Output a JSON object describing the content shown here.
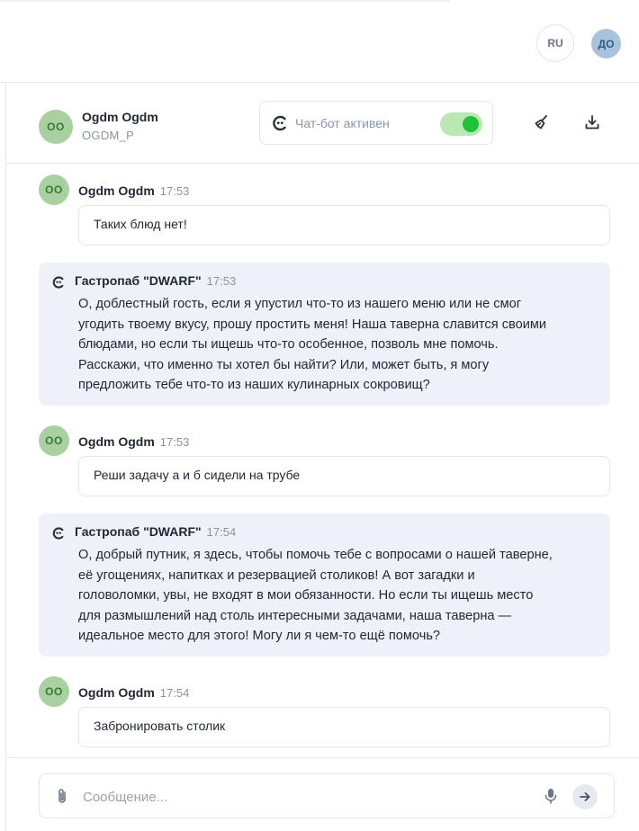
{
  "topbar": {
    "language": "RU",
    "user_initials": "ДО"
  },
  "chat_header": {
    "avatar_initials": "OO",
    "name": "Ogdm Ogdm",
    "username": "OGDM_P",
    "bot_status_label": "Чат-бот активен",
    "bot_enabled": true,
    "icons": [
      "robot-icon",
      "broom-icon",
      "download-icon"
    ]
  },
  "messages": [
    {
      "type": "user",
      "avatar": "OO",
      "author": "Ogdm Ogdm",
      "time": "17:53",
      "text": "Таких блюд нет!"
    },
    {
      "type": "bot",
      "author": "Гастропаб \"DWARF\"",
      "time": "17:53",
      "lines": [
        "О, доблестный гость, если я упустил что-то из нашего меню или не смог",
        "угодить твоему вкусу, прошу простить меня! Наша таверна славится своими",
        "блюдами, но если ты ищешь что-то особенное, позволь мне помочь.",
        "Расскажи, что именно ты хотел бы найти? Или, может быть, я могу",
        "предложить тебе что-то из наших кулинарных сокровищ?"
      ]
    },
    {
      "type": "user",
      "avatar": "OO",
      "author": "Ogdm Ogdm",
      "time": "17:53",
      "text": "Реши задачу а и б сидели на трубе"
    },
    {
      "type": "bot",
      "author": "Гастропаб \"DWARF\"",
      "time": "17:54",
      "lines": [
        "О, добрый путник, я здесь, чтобы помочь тебе с вопросами о нашей таверне,",
        "её угощениях, напитках и резервацией столиков! А вот загадки и",
        "головоломки, увы, не входят в мои обязанности. Но если ты ищешь место",
        "для размышлений над столь интересными задачами, наша таверна —",
        "идеальное место для этого! Могу ли я чем-то ещё помочь?"
      ]
    },
    {
      "type": "user",
      "avatar": "OO",
      "author": "Ogdm Ogdm",
      "time": "17:54",
      "text": "Забронировать столик"
    }
  ],
  "composer": {
    "placeholder": "Сообщение...",
    "value": ""
  },
  "colors": {
    "bot_bubble": "#eef1f9",
    "avatar_green": "#a8d0a0",
    "toggle_on": "#1fc23a"
  }
}
